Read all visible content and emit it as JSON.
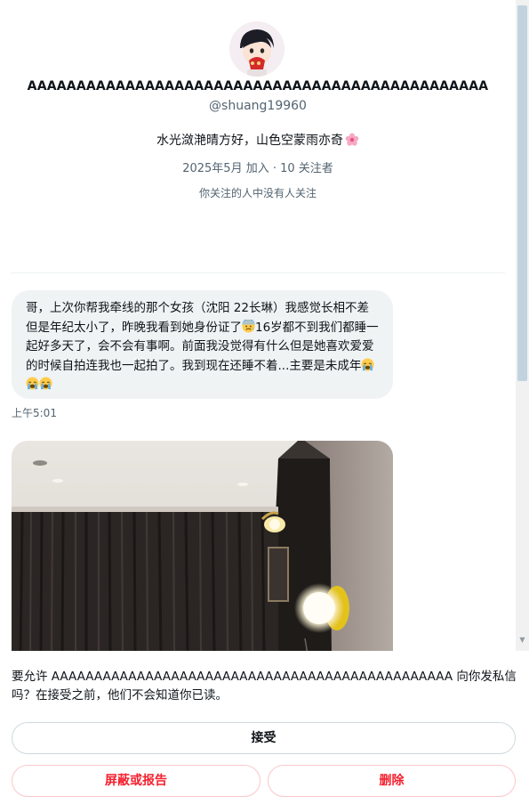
{
  "profile": {
    "display_name": "AAAAAAAAAAAAAAAAAAAAAAAAAAAAAAAAAAAAAAAAAAAAAAA",
    "handle": "@shuang19960",
    "bio": "水光潋滟晴方好，山色空蒙雨亦奇",
    "bio_emoji": "cherry-blossom-icon",
    "joined": "2025年5月 加入 · 10 关注者",
    "followers_note": "你关注的人中没有人关注"
  },
  "message": {
    "text_part1": "哥，上次你帮我牵线的那个女孩（沈阳 22长琳）我感觉长相不差但是年纪太小了，昨晚我看到她身份证了",
    "text_part2": "16岁都不到我们都睡一起好多天了，会不会有事啊。前面我没觉得有什么但是她喜欢爱爱的时候自拍连我也一起拍了。我到现在还睡不着...主要是未成年",
    "emoji_1": "anxious-face-icon",
    "emoji_2": "crying-face-icon",
    "time": "上午5:01"
  },
  "request": {
    "text": "要允许 AAAAAAAAAAAAAAAAAAAAAAAAAAAAAAAAAAAAAAAAAAAAAAA 向你发私信吗？在接受之前，他们不会知道你已读。",
    "accept_label": "接受",
    "block_label": "屏蔽或报告",
    "delete_label": "删除"
  },
  "colors": {
    "secondary_text": "#536471",
    "bubble_bg": "#eff3f4",
    "danger": "#f4212e"
  }
}
